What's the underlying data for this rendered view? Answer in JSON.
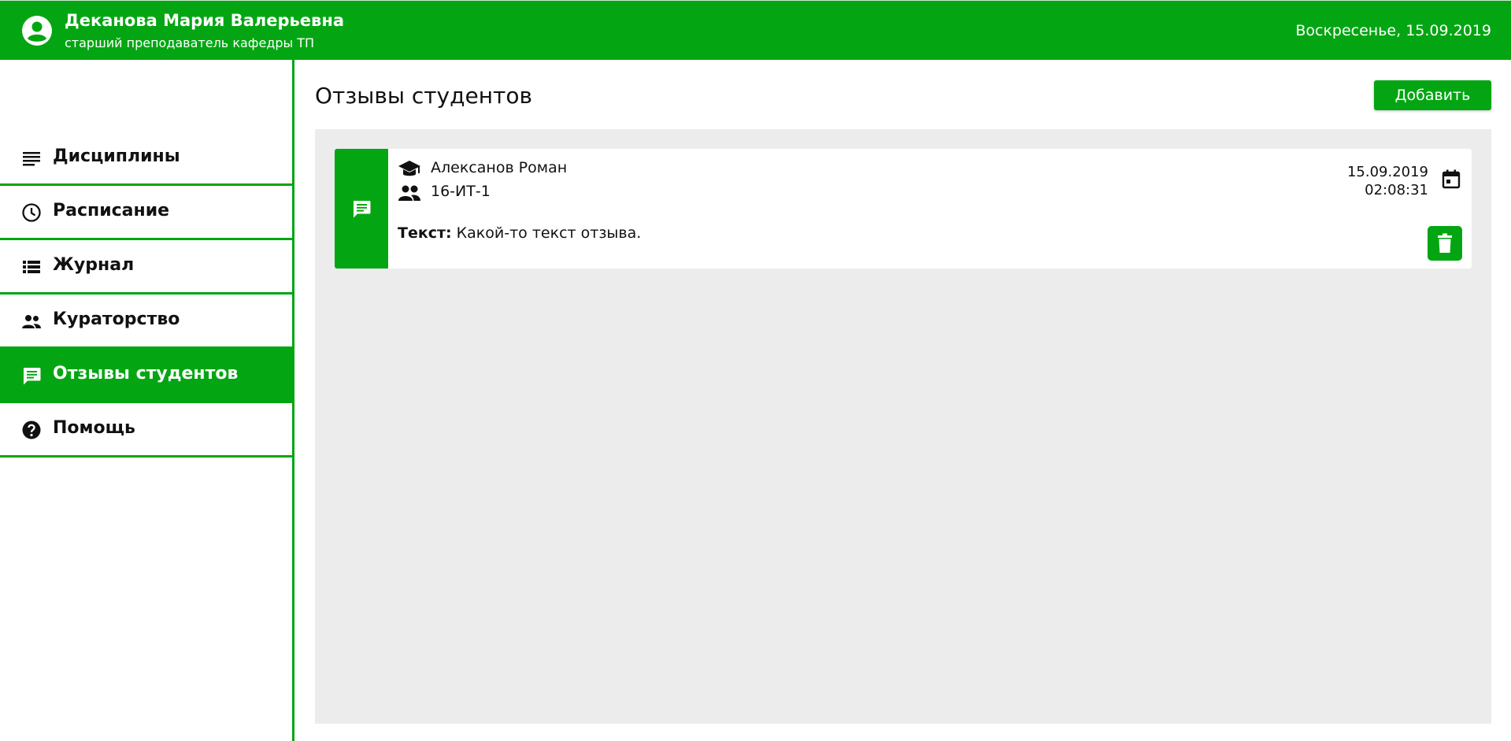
{
  "header": {
    "user_name": "Деканова Мария Валерьевна",
    "user_role": "старший преподаватель кафедры ТП",
    "date": "Воскресенье, 15.09.2019",
    "avatar_icon": "account-circle-icon",
    "brand_color": "#03a612"
  },
  "sidebar": {
    "items": [
      {
        "label": "Дисциплины",
        "icon": "subject-icon",
        "active": false
      },
      {
        "label": "Расписание",
        "icon": "clock-icon",
        "active": false
      },
      {
        "label": "Журнал",
        "icon": "list-icon",
        "active": false
      },
      {
        "label": "Кураторство",
        "icon": "people-icon",
        "active": false
      },
      {
        "label": "Отзывы студентов",
        "icon": "feedback-icon",
        "active": true
      },
      {
        "label": "Помощь",
        "icon": "help-icon",
        "active": false
      }
    ]
  },
  "main": {
    "title": "Отзывы студентов",
    "add_label": "Добавить",
    "reviews": [
      {
        "student": "Алексанов Роман",
        "group": "16-ИТ-1",
        "text_label": "Текст:",
        "text": "Какой-то текст отзыва.",
        "date": "15.09.2019",
        "time": "02:08:31"
      }
    ]
  }
}
